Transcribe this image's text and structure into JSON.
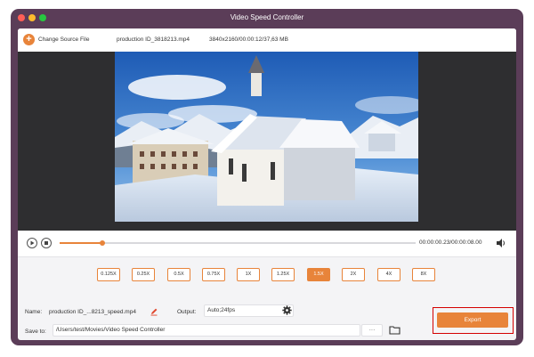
{
  "window": {
    "title": "Video Speed Controller",
    "traffic_lights": [
      "#ff5f57",
      "#febc2e",
      "#28c840"
    ]
  },
  "toolbar": {
    "change_source_label": "Change Source File",
    "change_source_icon": "plus-icon",
    "file_name": "production ID_3818213.mp4",
    "file_info": "3840x2160/00:00:12/37,63 MB"
  },
  "player": {
    "play_icon": "play-icon",
    "stop_icon": "stop-icon",
    "progress": 0.12,
    "time": "00:00:00.23/00:00:08.00",
    "volume_icon": "volume-icon"
  },
  "speeds": {
    "options": [
      "0.125X",
      "0.25X",
      "0.5X",
      "0.75X",
      "1X",
      "1.25X",
      "1.5X",
      "2X",
      "4X",
      "8X"
    ],
    "selected": "1.5X"
  },
  "output": {
    "name_label": "Name:",
    "name_value": "production ID_...8213_speed.mp4",
    "edit_icon": "pencil-icon",
    "output_label": "Output:",
    "output_value": "Auto;24fps",
    "settings_icon": "gear-icon",
    "save_label": "Save to:",
    "save_path": "/Users/test/Movies/Video Speed Controller",
    "more_label": "···",
    "folder_icon": "folder-icon",
    "export_label": "Export"
  },
  "colors": {
    "accent": "#e8843a",
    "window_frame": "#5b3d58",
    "highlight": "#d40000"
  }
}
